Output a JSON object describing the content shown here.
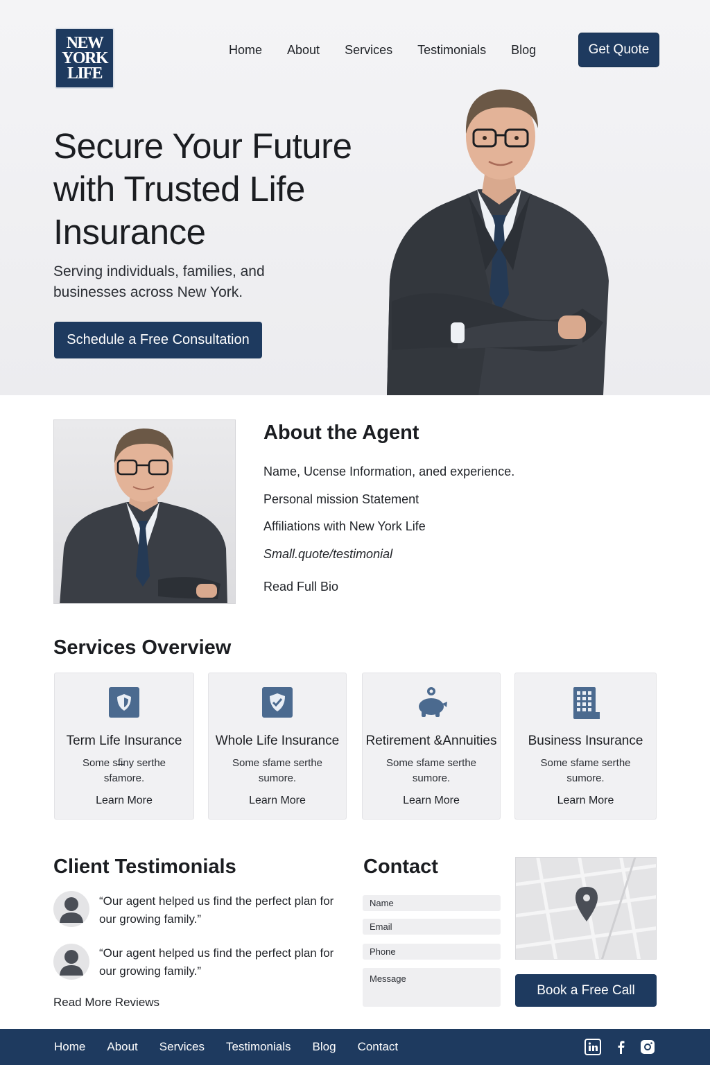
{
  "brand": {
    "logo_lines": [
      "NEW",
      "YORK",
      "LIFE"
    ],
    "color": "#1e3a5f"
  },
  "nav": {
    "items": [
      "Home",
      "About",
      "Services",
      "Testimonials",
      "Blog"
    ],
    "cta_label": "Get Quote"
  },
  "hero": {
    "title": "Secure Your Future with Trusted Life Insurance",
    "subtitle": "Serving individuals, families, and businesses across New York.",
    "cta_label": "Schedule a Free Consultation"
  },
  "about": {
    "title": "About the Agent",
    "lines": [
      "Name, Ucense Information, aned experience.",
      "Personal mission Statement",
      "Affiliations with New York Life",
      "Small.quote/testimonial"
    ],
    "bio_link": "Read Full Bio"
  },
  "services": {
    "title": "Services Overview",
    "cards": [
      {
        "icon": "shield-icon",
        "title": "Term Life Insurance",
        "desc": "Some sf̶iny serthe sfamore.",
        "link": "Learn More"
      },
      {
        "icon": "shield-check-icon",
        "title": "Whole Life Insurance",
        "desc": "Some sfame serthe sumore.",
        "link": "Learn More"
      },
      {
        "icon": "piggy-bank-icon",
        "title": "Retirement &Annuities",
        "desc": "Some sfame serthe sumore.",
        "link": "Learn More"
      },
      {
        "icon": "building-icon",
        "title": "Business Insurance",
        "desc": "Some sfame serthe sumore.",
        "link": "Learn More"
      }
    ]
  },
  "testimonials": {
    "title": "Client Testimonials",
    "items": [
      {
        "quote": "“Our agent helped us find the perfect plan for our growing family.”"
      },
      {
        "quote": "“Our agent helped us find the perfect plan for our growing family.”"
      }
    ],
    "more_link": "Read More Reviews"
  },
  "contact": {
    "title": "Contact",
    "fields": {
      "name": "Name",
      "email": "Email",
      "phone": "Phone",
      "message": "Message"
    },
    "cta_label": "Book a Free Call"
  },
  "footer": {
    "items": [
      "Home",
      "About",
      "Services",
      "Testimonials",
      "Blog",
      "Contact"
    ],
    "social_icons": [
      "linkedin-icon",
      "facebook-icon",
      "instagram-icon"
    ]
  }
}
